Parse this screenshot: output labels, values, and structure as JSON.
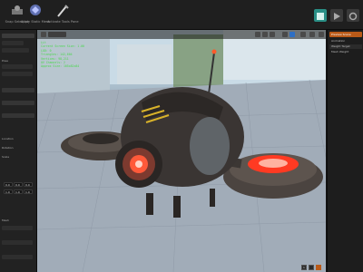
{
  "toolbar": {
    "buttons": [
      {
        "label": "Snap Selection",
        "icon": "snap-icon"
      },
      {
        "label": "Apply Static Mesh",
        "icon": "mesh-icon"
      },
      {
        "label": "Activate Tools Pane",
        "icon": "tools-icon"
      }
    ],
    "right_buttons": [
      {
        "icon": "preview-icon",
        "color": "#2a8f86"
      },
      {
        "icon": "play-icon",
        "color": "#3a3a3a"
      },
      {
        "icon": "settings-icon",
        "color": "#3a3a3a"
      }
    ]
  },
  "left_panel": {
    "labels": [
      "Pose",
      "Location",
      "Rotation",
      "Scale",
      "Mesh"
    ],
    "fields": [
      "0.0",
      "0.0",
      "0.0",
      "1.0",
      "1.0",
      "1.0"
    ]
  },
  "viewport": {
    "stats": [
      "Lit",
      "Current Screen Size: 1.00",
      "LOD: 0",
      "Triangles: 142,604",
      "Vertices: 98,211",
      "UV Channels: 2",
      "Approx Size: 105x82x84"
    ],
    "bottom_chip": "1"
  },
  "right_panel": {
    "tab": "Preview Scene",
    "items": [
      "Animation",
      "Weight Target",
      "Mesh Weight"
    ]
  },
  "colors": {
    "accent": "#ba5a18",
    "stats_text": "#49d84c",
    "glow": "#ff3a22"
  }
}
